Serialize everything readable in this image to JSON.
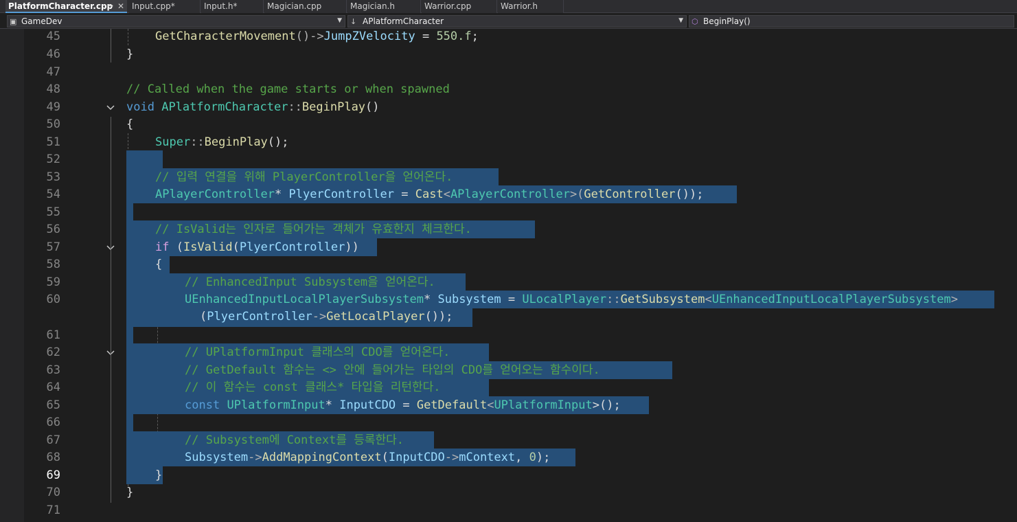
{
  "tabs": [
    {
      "label": "PlatformCharacter.cpp",
      "active": true,
      "pin": "⊸",
      "close": "✕"
    },
    {
      "label": "Input.cpp*"
    },
    {
      "label": "Input.h*"
    },
    {
      "label": "Magician.cpp"
    },
    {
      "label": "Magician.h"
    },
    {
      "label": "Warrior.cpp"
    },
    {
      "label": "Warrior.h"
    }
  ],
  "nav": {
    "project": "GameDev",
    "scope": "APlatformCharacter",
    "member": "BeginPlay()"
  },
  "editor": {
    "current_line": "69",
    "lines": [
      {
        "num": "45",
        "t": [
          "GetCharacterMovement",
          "()->",
          "JumpZVelocity",
          " = ",
          "550.f",
          ";"
        ]
      },
      {
        "num": "46",
        "t": [
          "}"
        ]
      },
      {
        "num": "47",
        "t": [
          ""
        ]
      },
      {
        "num": "48",
        "t": [
          "// Called when the game starts or when spawned"
        ]
      },
      {
        "num": "49",
        "t": [
          "void",
          " ",
          "APlatformCharacter",
          "::",
          "BeginPlay",
          "()"
        ]
      },
      {
        "num": "50",
        "t": [
          "{"
        ]
      },
      {
        "num": "51",
        "t": [
          "Super",
          "::",
          "BeginPlay",
          "();"
        ]
      },
      {
        "num": "52",
        "t": [
          ""
        ]
      },
      {
        "num": "53",
        "t": [
          "// 입력 연결을 위해 PlayerController을 얻어온다."
        ]
      },
      {
        "num": "54",
        "t": [
          "APlayerController",
          "* ",
          "PlyerController",
          " = ",
          "Cast",
          "<",
          "APlayerController",
          ">(",
          "GetController",
          "());"
        ]
      },
      {
        "num": "55",
        "t": [
          ""
        ]
      },
      {
        "num": "56",
        "t": [
          "// IsValid는 인자로 들어가는 객체가 유효한지 체크한다."
        ]
      },
      {
        "num": "57",
        "t": [
          "if",
          " (",
          "IsValid",
          "(",
          "PlyerController",
          "))"
        ]
      },
      {
        "num": "58",
        "t": [
          "{"
        ]
      },
      {
        "num": "59",
        "t": [
          "// EnhancedInput Subsystem을 얻어온다."
        ]
      },
      {
        "num": "60",
        "t": [
          "UEnhancedInputLocalPlayerSubsystem",
          "* ",
          "Subsystem",
          " = ",
          "ULocalPlayer",
          "::",
          "GetSubsystem",
          "<",
          "UEnhancedInputLocalPlayerSubsystem",
          ">"
        ]
      },
      {
        "num": "",
        "t": [
          "(",
          "PlyerController",
          "->",
          "GetLocalPlayer",
          "());"
        ]
      },
      {
        "num": "61",
        "t": [
          ""
        ]
      },
      {
        "num": "62",
        "t": [
          "// UPlatformInput 클래스의 CDO를 얻어온다."
        ]
      },
      {
        "num": "63",
        "t": [
          "// GetDefault 함수는 <> 안에 들어가는 타입의 CDO를 얻어오는 함수이다."
        ]
      },
      {
        "num": "64",
        "t": [
          "// 이 함수는 const 클래스* 타입을 리턴한다."
        ]
      },
      {
        "num": "65",
        "t": [
          "const",
          " ",
          "UPlatformInput",
          "* ",
          "InputCDO",
          " = ",
          "GetDefault",
          "<",
          "UPlatformInput",
          ">();"
        ]
      },
      {
        "num": "66",
        "t": [
          ""
        ]
      },
      {
        "num": "67",
        "t": [
          "// Subsystem에 Context를 등록한다."
        ]
      },
      {
        "num": "68",
        "t": [
          "Subsystem",
          "->",
          "AddMappingContext",
          "(",
          "InputCDO",
          "->",
          "mContext",
          ", ",
          "0",
          ");"
        ]
      },
      {
        "num": "69",
        "t": [
          "}"
        ]
      },
      {
        "num": "70",
        "t": [
          "}"
        ]
      },
      {
        "num": "71",
        "t": [
          ""
        ]
      }
    ]
  }
}
